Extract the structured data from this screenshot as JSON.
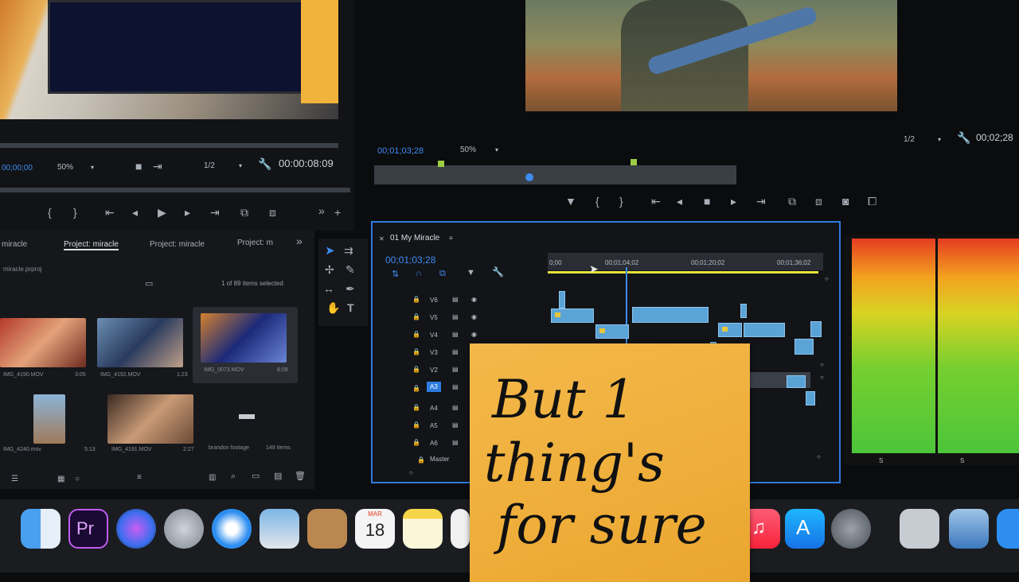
{
  "source_monitor": {
    "timecode_left": "00;00;00",
    "zoom": "50%",
    "resolution": "1/2",
    "duration": "00:00:08:09"
  },
  "program_monitor": {
    "timecode": "00;01;03;28",
    "zoom": "50%",
    "resolution": "1/2",
    "duration": "00;02;28"
  },
  "project_panel": {
    "tabs": [
      "miracle",
      "Project: miracle",
      "Project: miracle",
      "Project: m"
    ],
    "file": "miracle.prproj",
    "selection_status": "1 of 89 items selected",
    "items": [
      {
        "name": "IMG_4190.MOV",
        "duration": "3:05"
      },
      {
        "name": "IMG_4192.MOV",
        "duration": "1:23"
      },
      {
        "name": "IMG_0073.MOV",
        "duration": "8:09"
      },
      {
        "name": "IMG_4240.mov",
        "duration": "5:13"
      },
      {
        "name": "IMG_4191.MOV",
        "duration": "2:27"
      },
      {
        "name": "brandon footage",
        "duration": "149 Items"
      }
    ]
  },
  "timeline": {
    "sequence_name": "01 My Miracle",
    "playhead": "00;01;03;28",
    "ruler": [
      "0;00",
      "00;01;04;02",
      "00;01;20;02",
      "00;01;36;02"
    ],
    "video_tracks": [
      "V6",
      "V5",
      "V4",
      "V3",
      "V2"
    ],
    "audio_tracks": [
      "A3",
      "A4",
      "A5",
      "A6"
    ],
    "master": "Master"
  },
  "dock": {
    "calendar_month": "MAR",
    "calendar_day": "18",
    "premiere_label": "Pr"
  },
  "sticky_note": {
    "line1": "But 1",
    "line2": "thing's",
    "line3": "for sure"
  },
  "colors": {
    "accent_blue": "#3d8cf0",
    "sticky": "#efae3a",
    "playhead_yellow": "#e6e23b"
  }
}
